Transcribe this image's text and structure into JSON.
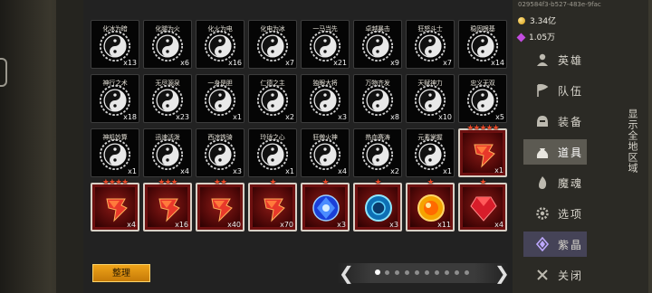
{
  "header": {
    "id_text": "029584f3-b527-483e-9fac",
    "coins": "3.34亿",
    "crystals": "1.05万"
  },
  "menu": [
    {
      "label": "英雄",
      "icon": "person-icon"
    },
    {
      "label": "队伍",
      "icon": "flag-icon"
    },
    {
      "label": "装备",
      "icon": "helmet-icon"
    },
    {
      "label": "道具",
      "icon": "bag-icon",
      "active": true
    },
    {
      "label": "魔魂",
      "icon": "flame-icon"
    },
    {
      "label": "选项",
      "icon": "gear-icon"
    },
    {
      "label": "紫晶",
      "icon": "crystal-icon",
      "purple": true
    },
    {
      "label": "关闭",
      "icon": "close-icon"
    }
  ],
  "side_label": "显示全地区域",
  "sort_button": "整理",
  "pager": {
    "prev": "❮",
    "next": "❯",
    "pages": 10,
    "current": 1
  },
  "items": [
    {
      "name": "化冰为暗",
      "count": "x13",
      "kind": "yy"
    },
    {
      "name": "化腿为火",
      "count": "x6",
      "kind": "yy"
    },
    {
      "name": "化火为电",
      "count": "x16",
      "kind": "yy"
    },
    {
      "name": "化电为冰",
      "count": "x7",
      "kind": "yy"
    },
    {
      "name": "一马当先",
      "count": "x21",
      "kind": "yy"
    },
    {
      "name": "卓越暴击",
      "count": "x9",
      "kind": "yy"
    },
    {
      "name": "狂怒斗士",
      "count": "x7",
      "kind": "yy"
    },
    {
      "name": "稳固根基",
      "count": "x14",
      "kind": "yy"
    },
    {
      "name": "神行之术",
      "count": "x18",
      "kind": "yy"
    },
    {
      "name": "无尽源泉",
      "count": "x23",
      "kind": "yy"
    },
    {
      "name": "一身是胆",
      "count": "x1",
      "kind": "yy"
    },
    {
      "name": "仁德之主",
      "count": "x2",
      "kind": "yy"
    },
    {
      "name": "独眼大将",
      "count": "x3",
      "kind": "yy"
    },
    {
      "name": "万物齐发",
      "count": "x8",
      "kind": "yy"
    },
    {
      "name": "天赋神力",
      "count": "x10",
      "kind": "yy"
    },
    {
      "name": "忠义无双",
      "count": "x5",
      "kind": "yy"
    },
    {
      "name": "神机妙算",
      "count": "x1",
      "kind": "yy"
    },
    {
      "name": "迅速活泼",
      "count": "x4",
      "kind": "yy"
    },
    {
      "name": "西凉铁骑",
      "count": "x3",
      "kind": "yy"
    },
    {
      "name": "玲珑之心",
      "count": "x1",
      "kind": "yy"
    },
    {
      "name": "狂傲火神",
      "count": "x4",
      "kind": "yy"
    },
    {
      "name": "热血赛涛",
      "count": "x2",
      "kind": "yy"
    },
    {
      "name": "元素掌握",
      "count": "x1",
      "kind": "yy"
    },
    {
      "name": "",
      "count": "x1",
      "kind": "shard",
      "stars": "★★★★★"
    },
    {
      "name": "",
      "count": "x4",
      "kind": "shard",
      "stars": "★★★★"
    },
    {
      "name": "",
      "count": "x16",
      "kind": "shard",
      "stars": "★★★"
    },
    {
      "name": "",
      "count": "x40",
      "kind": "shard",
      "stars": "★★"
    },
    {
      "name": "",
      "count": "x70",
      "kind": "shard",
      "stars": "★"
    },
    {
      "name": "",
      "count": "x3",
      "kind": "sapphire",
      "stars": "★"
    },
    {
      "name": "",
      "count": "x3",
      "kind": "orb",
      "stars": "★"
    },
    {
      "name": "",
      "count": "x11",
      "kind": "dragonball",
      "stars": "★"
    },
    {
      "name": "",
      "count": "x4",
      "kind": "ruby",
      "stars": "★"
    }
  ]
}
